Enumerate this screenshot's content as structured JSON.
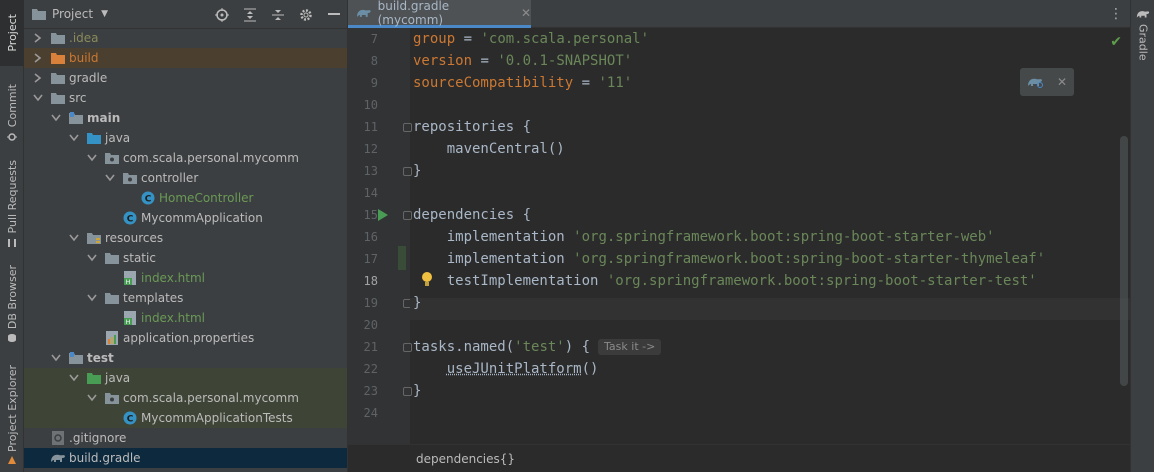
{
  "left_strip": {
    "tabs": [
      {
        "label": "Project",
        "active": true
      },
      {
        "label": "Commit"
      },
      {
        "label": "Pull Requests"
      },
      {
        "label": "DB Browser"
      },
      {
        "label": "Project Explorer"
      }
    ]
  },
  "project": {
    "title": "Project",
    "tree": [
      {
        "label": ".idea",
        "depth": 1,
        "expanded": false,
        "icon": "folder-icon",
        "style": "olive"
      },
      {
        "label": "build",
        "depth": 1,
        "expanded": false,
        "icon": "folder-orange-icon",
        "style": "orange",
        "bg": "build"
      },
      {
        "label": "gradle",
        "depth": 1,
        "expanded": false,
        "icon": "folder-icon",
        "style": "white"
      },
      {
        "label": "src",
        "depth": 1,
        "expanded": true,
        "icon": "folder-icon",
        "style": "white"
      },
      {
        "label": "main",
        "depth": 2,
        "expanded": true,
        "icon": "folder-module-icon",
        "style": "bold"
      },
      {
        "label": "java",
        "depth": 3,
        "expanded": true,
        "icon": "folder-source-icon",
        "style": "white"
      },
      {
        "label": "com.scala.personal.mycomm",
        "depth": 4,
        "expanded": true,
        "icon": "package-icon",
        "style": "white"
      },
      {
        "label": "controller",
        "depth": 5,
        "expanded": true,
        "icon": "package-icon",
        "style": "white"
      },
      {
        "label": "HomeController",
        "depth": 6,
        "icon": "class-icon",
        "style": "green"
      },
      {
        "label": "MycommApplication",
        "depth": 5,
        "icon": "class-icon",
        "style": "white"
      },
      {
        "label": "resources",
        "depth": 3,
        "expanded": true,
        "icon": "folder-resources-icon",
        "style": "white"
      },
      {
        "label": "static",
        "depth": 4,
        "expanded": true,
        "icon": "folder-icon",
        "style": "white"
      },
      {
        "label": "index.html",
        "depth": 5,
        "icon": "html-file-icon",
        "style": "green"
      },
      {
        "label": "templates",
        "depth": 4,
        "expanded": true,
        "icon": "folder-icon",
        "style": "white"
      },
      {
        "label": "index.html",
        "depth": 5,
        "icon": "html-file-icon",
        "style": "green"
      },
      {
        "label": "application.properties",
        "depth": 4,
        "icon": "properties-file-icon",
        "style": "white"
      },
      {
        "label": "test",
        "depth": 2,
        "expanded": true,
        "icon": "folder-module-icon",
        "style": "bold"
      },
      {
        "label": "java",
        "depth": 3,
        "expanded": true,
        "icon": "folder-test-icon",
        "style": "white",
        "bg": "test"
      },
      {
        "label": "com.scala.personal.mycomm",
        "depth": 4,
        "expanded": true,
        "icon": "package-icon",
        "style": "white",
        "bg": "test"
      },
      {
        "label": "MycommApplicationTests",
        "depth": 5,
        "icon": "class-icon",
        "style": "white",
        "bg": "test"
      },
      {
        "label": ".gitignore",
        "depth": 1,
        "icon": "gitignore-file-icon",
        "style": "white"
      },
      {
        "label": "build.gradle",
        "depth": 1,
        "icon": "gradle-file-icon",
        "style": "white",
        "bg": "sel"
      }
    ]
  },
  "editor": {
    "tab_label": "build.gradle (mycomm)",
    "current_line": 18,
    "lines": [
      {
        "n": 7,
        "html": "<span class='k'>group</span> <span class='t'>=</span> <span class='s'>'com.scala.personal'</span>"
      },
      {
        "n": 8,
        "html": "<span class='k'>version</span> <span class='t'>=</span> <span class='s'>'0.0.1-SNAPSHOT'</span>"
      },
      {
        "n": 9,
        "html": "<span class='k'>sourceCompatibility</span> <span class='t'>=</span> <span class='s'>'11'</span>"
      },
      {
        "n": 10,
        "html": ""
      },
      {
        "n": 11,
        "html": "<span class='t'>repositories {</span>"
      },
      {
        "n": 12,
        "html": "<span class='t'>    mavenCentral()</span>"
      },
      {
        "n": 13,
        "html": "<span class='t'>}</span>"
      },
      {
        "n": 14,
        "html": ""
      },
      {
        "n": 15,
        "html": "<span class='t'>dependencies {</span>"
      },
      {
        "n": 16,
        "html": "<span class='t'>    implementation </span><span class='s'>'org.springframework.boot:spring-boot-starter-web'</span>"
      },
      {
        "n": 17,
        "html": "<span class='t'>    implementation </span><span class='s'>'org.springframework.boot:spring-boot-starter-thymeleaf'</span>"
      },
      {
        "n": 18,
        "html": "<span class='t'>    testImplementation </span><span class='s'>'org.springframework.boot:spring-boot-starter-test'</span>"
      },
      {
        "n": 19,
        "html": "<span class='t'>}</span>"
      },
      {
        "n": 20,
        "html": ""
      },
      {
        "n": 21,
        "html": "<span class='t'>tasks.named(</span><span class='s'>'test'</span><span class='t'>) {</span><span class='hint'>Task it -&gt;</span>"
      },
      {
        "n": 22,
        "html": "<span class='t'>    </span><span class='t ul'>useJUnitPlatform</span><span class='t'>()</span>"
      },
      {
        "n": 23,
        "html": "<span class='t'>}</span>"
      },
      {
        "n": 24,
        "html": ""
      }
    ],
    "breadcrumb": "dependencies{}"
  },
  "right_strip": {
    "tab_label": "Gradle"
  },
  "colors": {
    "keyword": "#cc7832",
    "string": "#6a8759",
    "text": "#a9b7c6",
    "accent": "#4a88c7"
  }
}
